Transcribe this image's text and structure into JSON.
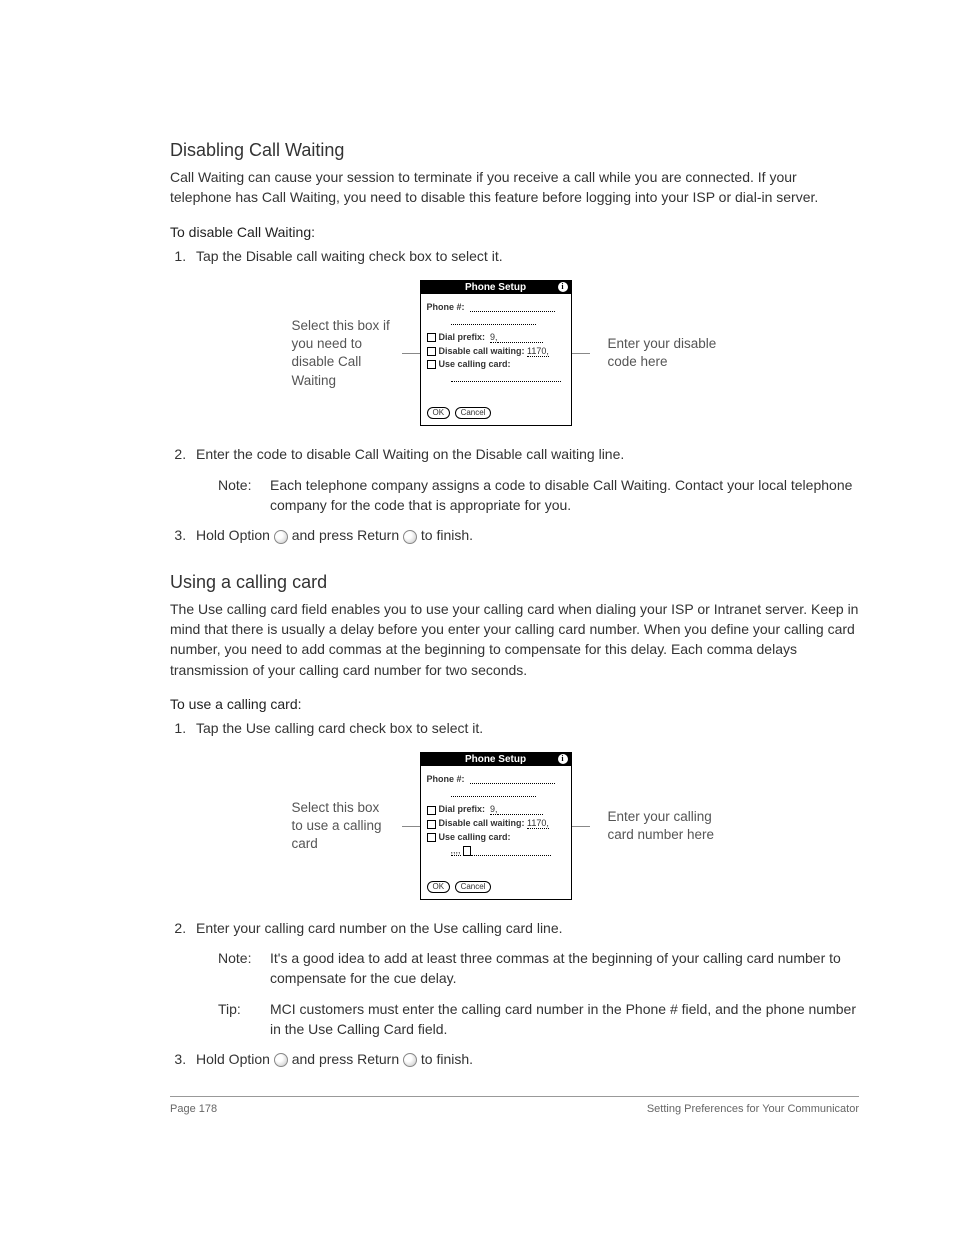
{
  "section1": {
    "heading": "Disabling Call Waiting",
    "intro": "Call Waiting can cause your session to terminate if you receive a call while you are connected. If your telephone has Call Waiting, you need to disable this feature before logging into your ISP or dial-in server.",
    "howto": "To disable Call Waiting:",
    "step1": "Tap the Disable call waiting check box to select it.",
    "callout_left": "Select this box if you need to disable Call Waiting",
    "callout_right": "Enter your disable code here",
    "step2": "Enter the code to disable Call Waiting on the Disable call waiting line.",
    "note_label": "Note:",
    "note_text": "Each telephone company assigns a code to disable Call Waiting. Contact your local telephone company for the code that is appropriate for you.",
    "step3_a": "Hold Option ",
    "step3_b": " and press Return ",
    "step3_c": " to finish."
  },
  "device": {
    "title": "Phone Setup",
    "phone_label": "Phone #:",
    "dial_prefix": "Dial prefix:",
    "dial_prefix_val": "9,",
    "disable_cw": "Disable call waiting:",
    "disable_cw_val": "1170,",
    "use_card": "Use calling card:",
    "comma_val": ",,,,",
    "ok": "OK",
    "cancel": "Cancel"
  },
  "section2": {
    "heading": "Using a calling card",
    "intro": "The Use calling card field enables you to use your calling card when dialing your ISP or Intranet server. Keep in mind that there is usually a delay before you enter your calling card number. When you define your calling card number, you need to add commas at the beginning to compensate for this delay. Each comma delays transmission of your calling card number for two seconds.",
    "howto": "To use a calling card:",
    "step1": "Tap the Use calling card check box to select it.",
    "callout_left": "Select this box to use a calling card",
    "callout_right": "Enter your calling card number here",
    "step2": "Enter your calling card number on the Use calling card line.",
    "note_label": "Note:",
    "note_text": "It's a good idea to add at least three commas at the beginning of your calling card number to compensate for the cue delay.",
    "tip_label": "Tip:",
    "tip_text": "MCI customers must enter the calling card number in the Phone # field, and the phone number in the Use Calling Card field.",
    "step3_a": "Hold Option ",
    "step3_b": " and press Return ",
    "step3_c": " to finish."
  },
  "footer": {
    "left": "Page 178",
    "right": "Setting Preferences for Your Communicator"
  }
}
